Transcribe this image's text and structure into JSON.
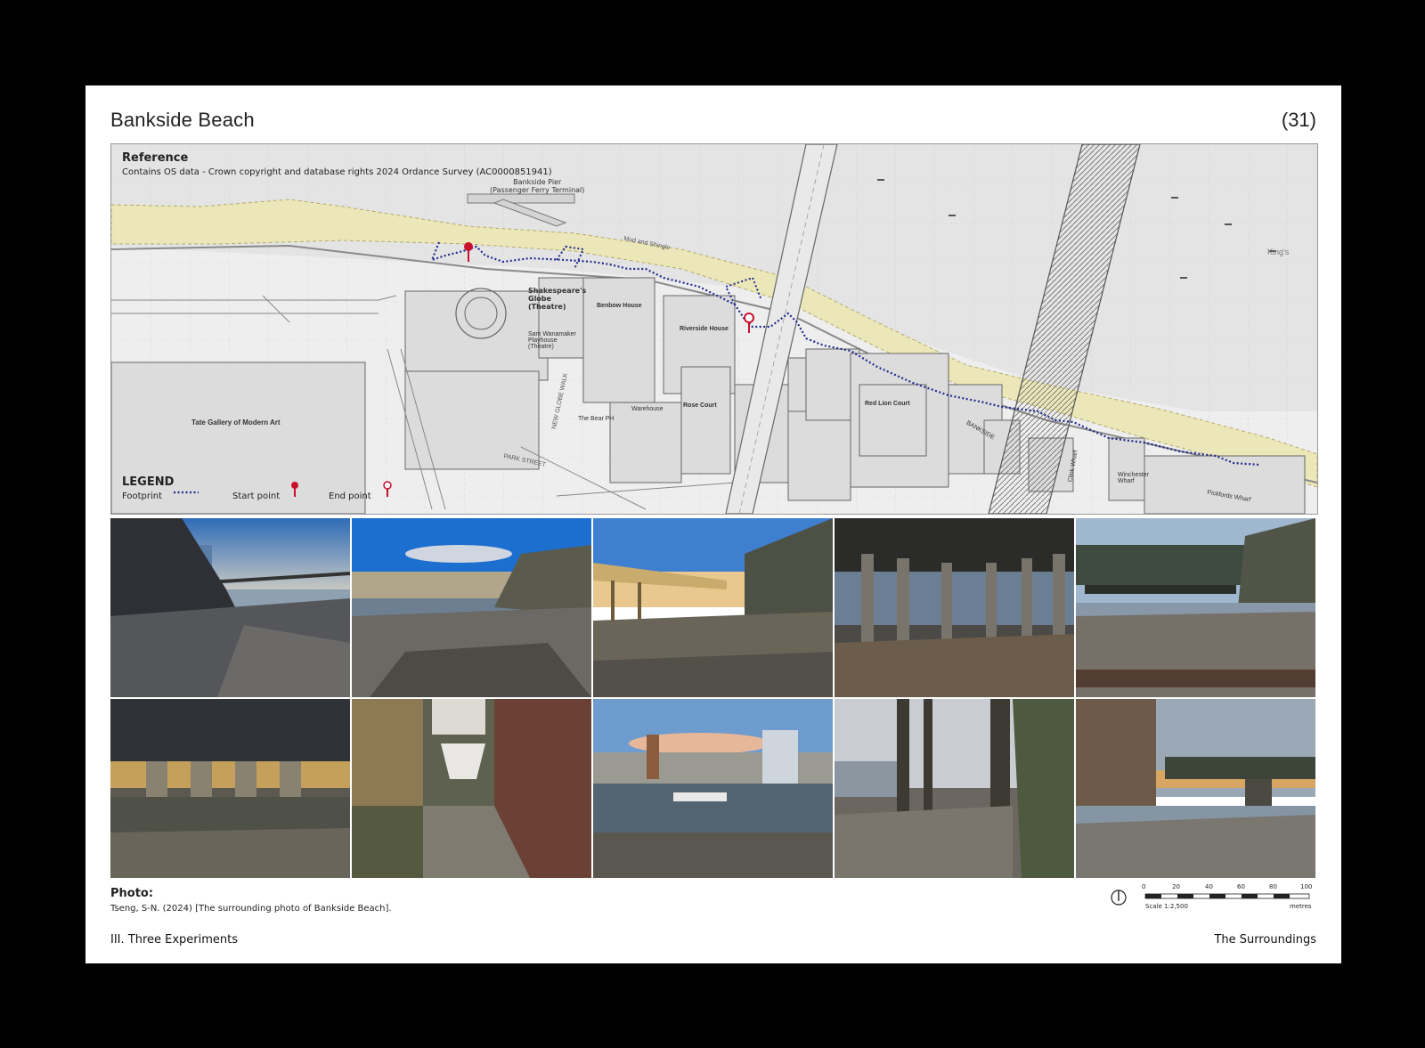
{
  "page": {
    "title": "Bankside Beach",
    "number": "(31)"
  },
  "map": {
    "reference_title": "Reference",
    "reference_text": "Contains OS data - Crown copyright and database rights 2024 Ordance Survey (AC0000851941)",
    "legend_title": "LEGEND",
    "legend_footprint": "Footprint",
    "legend_start": "Start point",
    "legend_end": "End point",
    "labels": {
      "pier": "Bankside Pier",
      "pier_sub": "(Passenger Ferry Terminal)",
      "globe": "Shakespeare's Globe (Theatre)",
      "bembow": "Benbow House",
      "riverside": "Riverside House",
      "wanamaker": "Sam Wanamaker Playhouse (Theatre)",
      "tate": "Tate Gallery of Modern Art",
      "rose": "Rose Court",
      "warehouse": "Warehouse",
      "bear": "The Bear PH",
      "redlion": "Red Lion Court",
      "bankside": "BANKSIDE",
      "mud": "Mud and Shingle",
      "kings": "King's",
      "park_street": "PARK STREET",
      "new_globe": "NEW GLOBE WALK",
      "clink": "Clink Wharf",
      "winchester": "Winchester Wharf",
      "pickfords": "Pickfords Wharf"
    }
  },
  "photos": [
    {
      "name": "photo-1",
      "desc": "millennium-bridge"
    },
    {
      "name": "photo-2",
      "desc": "foreshore-city"
    },
    {
      "name": "photo-3",
      "desc": "pier-sunset"
    },
    {
      "name": "photo-4",
      "desc": "under-pier-columns"
    },
    {
      "name": "photo-5",
      "desc": "railway-bridge"
    },
    {
      "name": "photo-6",
      "desc": "under-bridge-piers"
    },
    {
      "name": "photo-7",
      "desc": "dock-boat"
    },
    {
      "name": "photo-8",
      "desc": "river-panorama"
    },
    {
      "name": "photo-9",
      "desc": "wooden-pilings"
    },
    {
      "name": "photo-10",
      "desc": "bridge-dusk"
    }
  ],
  "caption": {
    "title": "Photo:",
    "text": "Tseng, S-N. (2024) [The surrounding photo of Bankside Beach]."
  },
  "scale": {
    "ticks": [
      "0",
      "20",
      "40",
      "60",
      "80",
      "100"
    ],
    "label": "Scale 1:2,500",
    "unit": "metres"
  },
  "footer": {
    "left": "III. Three Experiments",
    "right": "The Surroundings"
  },
  "colors": {
    "beach": "#ece7b8",
    "footprint": "#1f2a8c",
    "marker": "#c8102e"
  }
}
